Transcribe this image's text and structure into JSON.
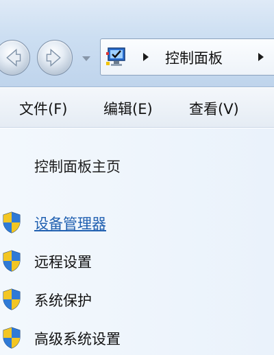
{
  "address": {
    "icon": "control-panel-icon",
    "crumbs": [
      "控制面板"
    ]
  },
  "menu": {
    "file": "文件(F)",
    "edit": "编辑(E)",
    "view": "查看(V)"
  },
  "pane": {
    "home": "控制面板主页",
    "tasks": [
      {
        "label": "设备管理器",
        "icon": "uac-shield-icon",
        "active": true
      },
      {
        "label": "远程设置",
        "icon": "uac-shield-icon",
        "active": false
      },
      {
        "label": "系统保护",
        "icon": "uac-shield-icon",
        "active": false
      },
      {
        "label": "高级系统设置",
        "icon": "uac-shield-icon",
        "active": false
      }
    ]
  },
  "colors": {
    "link_active": "#1f5fb0",
    "chrome_blue": "#cddff2"
  }
}
